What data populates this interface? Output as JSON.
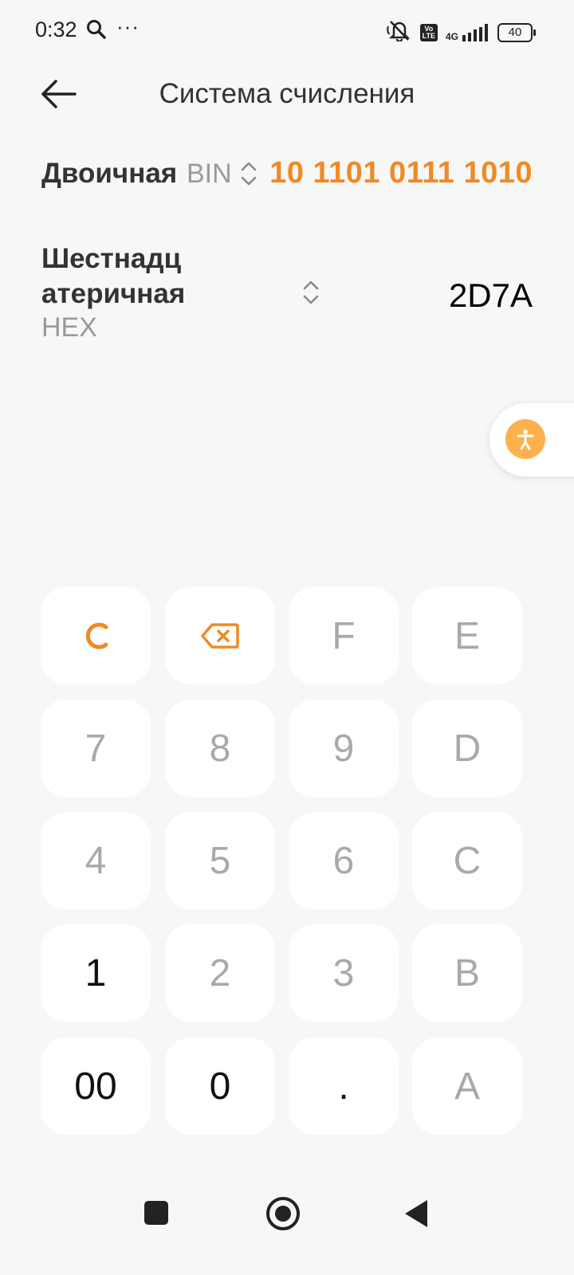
{
  "status_bar": {
    "time": "0:32",
    "dots": "···",
    "volte": "Vo\nLTE",
    "network": "4G",
    "battery": "40"
  },
  "header": {
    "title": "Система счисления"
  },
  "from": {
    "label": "Двоичная",
    "code": "BIN",
    "value": "10 1101 0111 1010"
  },
  "to": {
    "label_line1": "Шестнадц",
    "label_line2": "атеричная",
    "code": "HEX",
    "value": "2D7A"
  },
  "keypad": {
    "keys": [
      "C",
      "backspace",
      "F",
      "E",
      "7",
      "8",
      "9",
      "D",
      "4",
      "5",
      "6",
      "C",
      "1",
      "2",
      "3",
      "B",
      "00",
      "0",
      ".",
      "A"
    ]
  },
  "colors": {
    "accent": "#f08a24",
    "float_button": "#fdb14d",
    "disabled_key_text": "#a9a9a9",
    "background": "#f7f7f7"
  }
}
